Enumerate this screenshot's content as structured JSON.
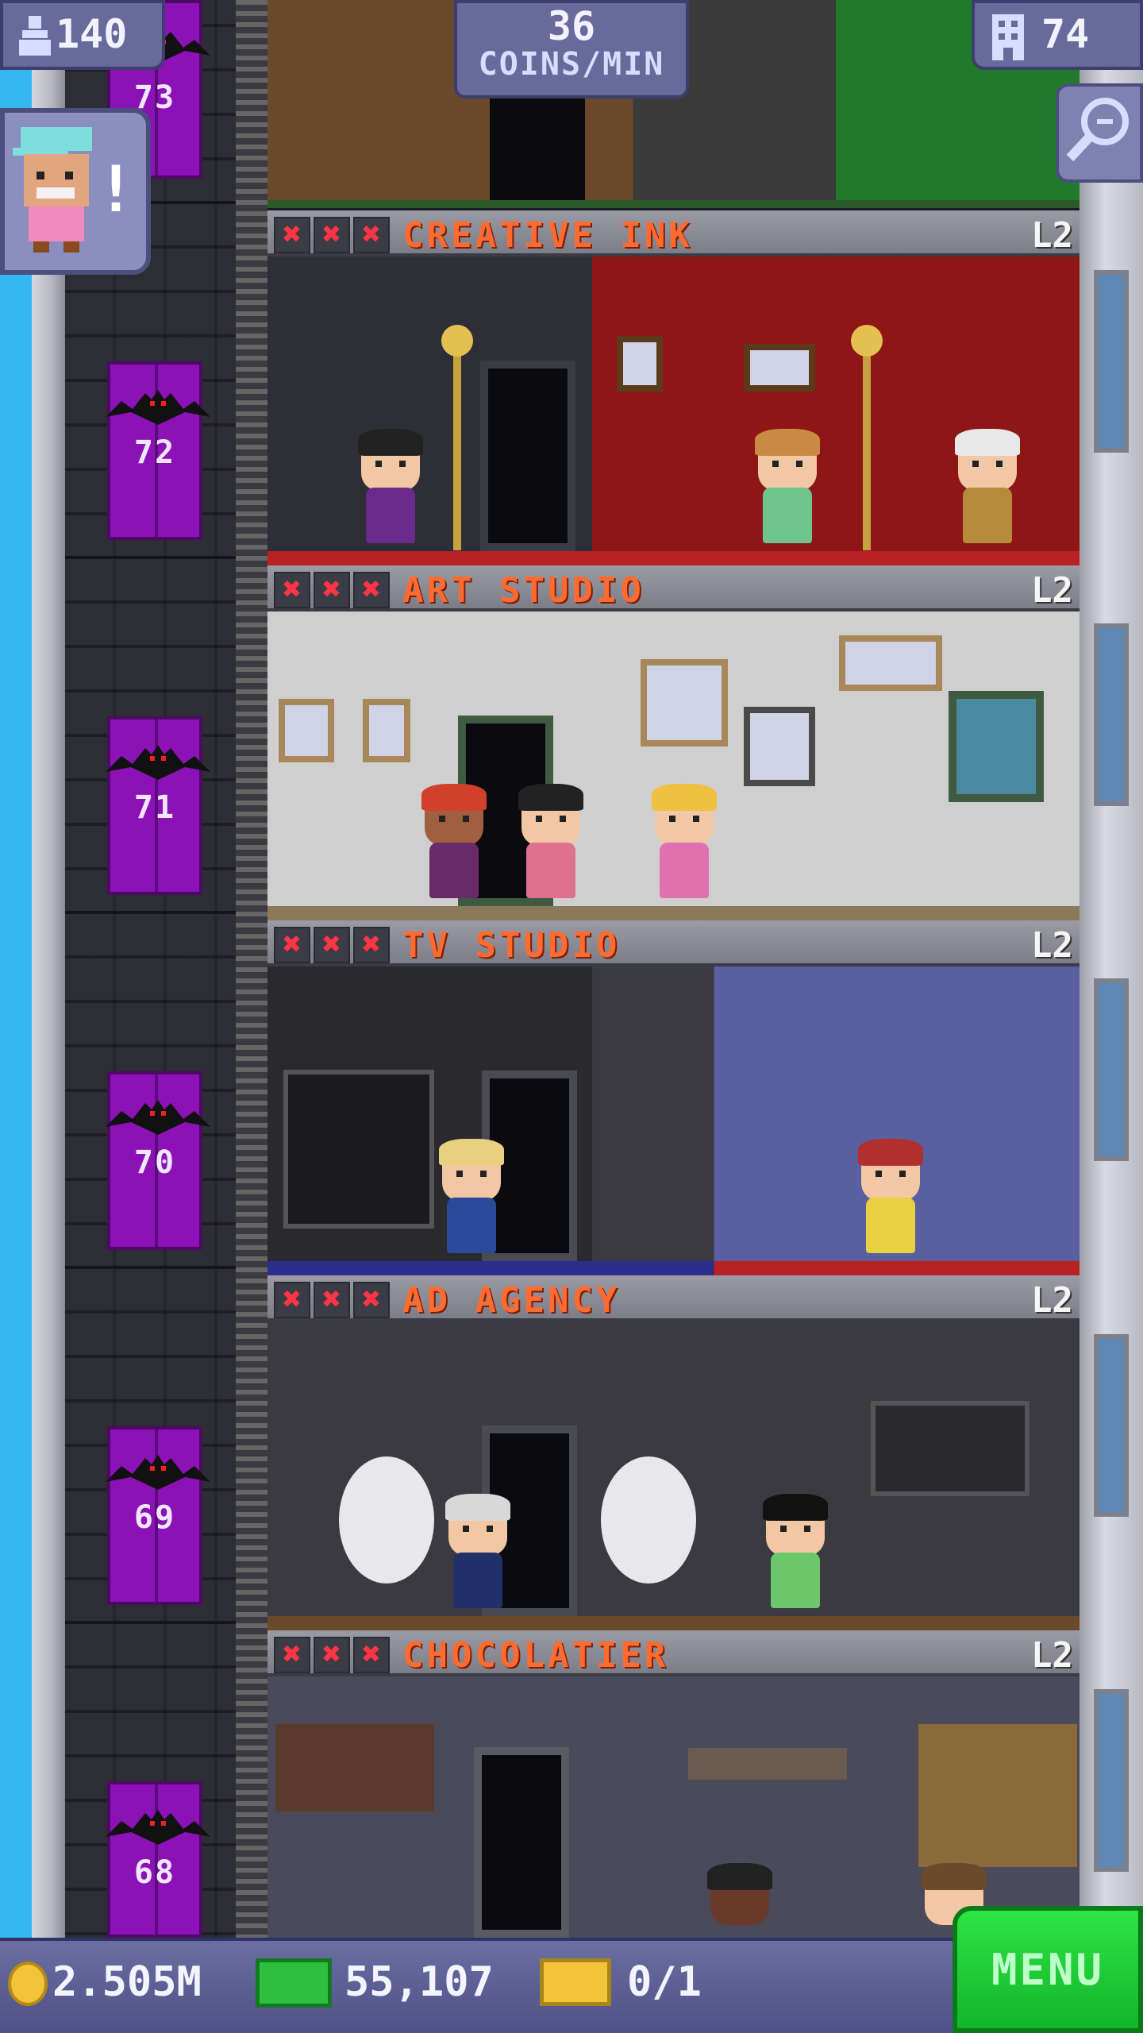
{
  "hud": {
    "population": "140",
    "rate_value": "36",
    "rate_unit": "COINS/MIN",
    "floors_count": "74"
  },
  "floors": [
    {
      "name": "CREATIVE INK",
      "level": "L2",
      "stars": [
        "✖",
        "✖",
        "✖"
      ]
    },
    {
      "name": "ART STUDIO",
      "level": "L2",
      "stars": [
        "✖",
        "✖",
        "✖"
      ]
    },
    {
      "name": "TV STUDIO",
      "level": "L2",
      "stars": [
        "✖",
        "✖",
        "✖"
      ]
    },
    {
      "name": "AD AGENCY",
      "level": "L2",
      "stars": [
        "✖",
        "✖",
        "✖"
      ]
    },
    {
      "name": "CHOCOLATIER",
      "level": "L2",
      "stars": [
        "✖",
        "✖",
        "✖"
      ]
    }
  ],
  "elevator_floors": [
    "73",
    "72",
    "71",
    "70",
    "69",
    "68"
  ],
  "bottom_bar": {
    "coins": "2.505M",
    "bux": "55,107",
    "tickets": "0/1",
    "menu_label": "MENU"
  },
  "avatar_alert": "!",
  "colors": {
    "elevator": "#8c12b8",
    "floor_name": "#ff6a2e",
    "menu_green": "#21d23a",
    "hud_blue": "#676a9a"
  }
}
